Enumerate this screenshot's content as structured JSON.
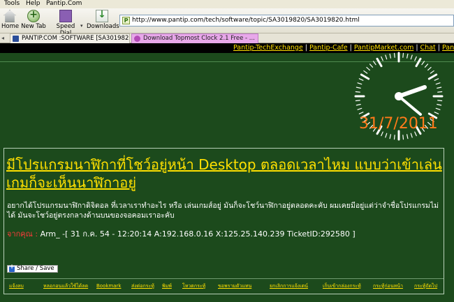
{
  "menu": [
    "Tools",
    "Help",
    "Pantip.Com"
  ],
  "toolbar": {
    "home": "Home",
    "new_tab": "New Tab",
    "speed_dial": "Speed Dial",
    "downloads": "Downloads",
    "url": "http://www.pantip.com/tech/software/topic/SA3019820/SA3019820.html"
  },
  "tabs": [
    {
      "label": "PANTIP.COM :SOFTWARE [SA3019820] ...",
      "icon": "pantip-favicon",
      "color": "#f2f0e8"
    },
    {
      "label": "Download Topmost Clock 2.1 Free - ...",
      "icon": "download-site-favicon",
      "color": "#e8a8ea"
    }
  ],
  "topnav": [
    "Pantip-TechExchange",
    "Pantip-Cafe",
    "PantipMarket.com",
    "Chat",
    "PanTown.com"
  ],
  "clock": {
    "date": "31/7/2011",
    "time": "12:20",
    "color": "#ff7a1a"
  },
  "post": {
    "title": "มีโปรแกรมนาฬิกาที่โชว์อยู่หน้า Desktop ตลอดเวลาไหม แบบว่าเข้าเล่นเกมก็จะเห็นนาฬิกาอยู่",
    "body": "อยากได้โปรแกรมนาฬิกาดิจิตอล ที่เวลาเราทำอะไร หรือ เล่นเกมส์อยู่ มันก็จะโชว์นาฬิกาอยู่ตลอดคะคับ ผมเคยมีอยู่แต่ว่าจำชื่อโปรแกรมไม่ได้ มันจะโชว์อยู่ตรงกลางด้านบนของจอคอมเราอะคับ",
    "from_label": "จากคุณ :",
    "from_value": "Arm_ -[ 31 ก.ค. 54 - 12:20:14 A:192.168.0.16 X:125.25.140.239 TicketID:292580 ]",
    "share": "Share / Save"
  },
  "bottom_links": [
    "แจ้งลบ",
    "หลอกอนแล้วใช้ได้ลด",
    "Bookmark",
    "ส่งต่อกระทู้",
    "พิมพ์",
    "โหวตกระทู้",
    "ขอพรามตัวแทน",
    "ยกเลิกการแจ้งเตน์",
    "เก็บเข้ากล่องกระทู้",
    "กระทู้ก่อนหน้า",
    "กระทู้ถัดไป"
  ],
  "colors": {
    "page_bg": "#1c4a1c",
    "link": "#ffe000",
    "from_label": "#ff3a3a"
  }
}
